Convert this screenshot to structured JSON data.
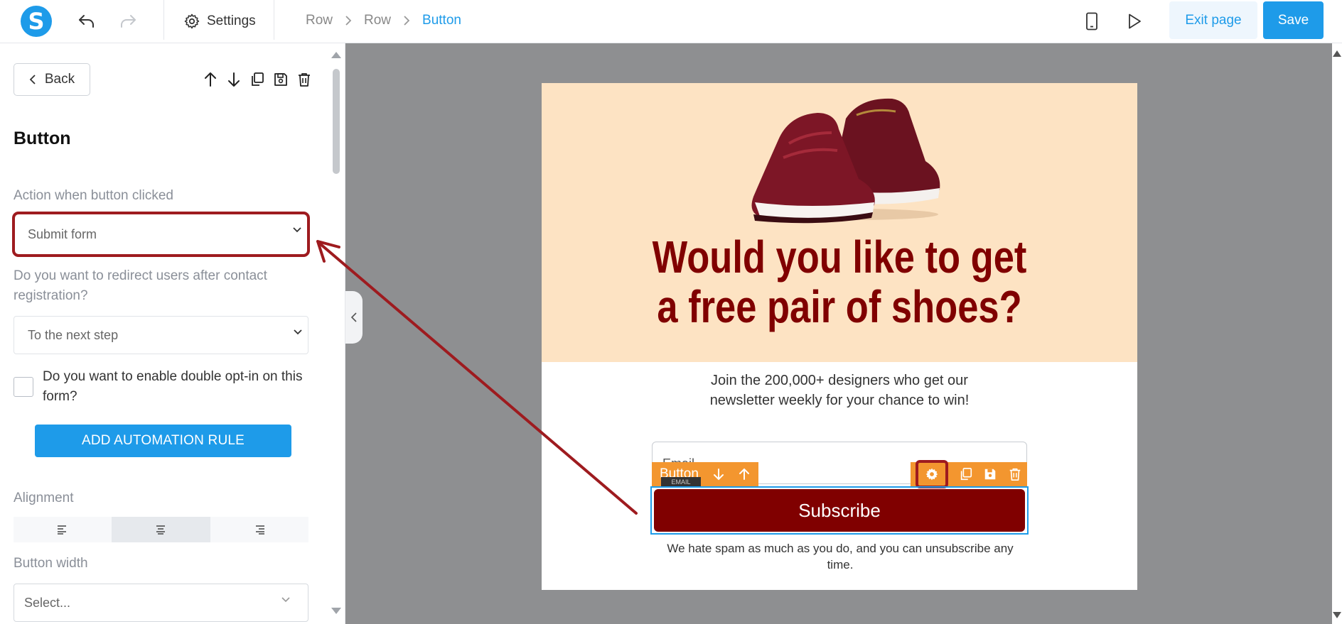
{
  "topbar": {
    "logo_letter": "S",
    "settings_label": "Settings",
    "breadcrumbs": [
      "Row",
      "Row",
      "Button"
    ],
    "exit_label": "Exit page",
    "save_label": "Save"
  },
  "panel": {
    "back_label": "Back",
    "title": "Button",
    "action_label": "Action when button clicked",
    "action_value": "Submit form",
    "redirect_label": "Do you want to redirect users after contact registration?",
    "redirect_value": "To the next step",
    "double_optin_label": "Do you want to enable double opt-in on this form?",
    "double_optin_checked": false,
    "automation_label": "ADD AUTOMATION RULE",
    "alignment_label": "Alignment",
    "alignment_selected": "center",
    "width_label": "Button width",
    "width_placeholder": "Select..."
  },
  "canvas": {
    "headline_line1": "Would you like to get",
    "headline_line2": "a free pair of shoes?",
    "subtext_line1": "Join the 200,000+ designers who get our",
    "subtext_line2": "newsletter weekly for your chance to win!",
    "email_placeholder": "Email",
    "email_tag": "EMAIL",
    "toolbar_label": "Button",
    "subscribe_label": "Subscribe",
    "spam_line1": "We hate spam as much as you do, and you can unsubscribe any",
    "spam_line2": "time."
  },
  "colors": {
    "accent": "#1e9be9",
    "hero_bg": "#fde3c3",
    "headline": "#800000",
    "toolbar": "#f3962f",
    "annotation": "#9e1b1f"
  }
}
